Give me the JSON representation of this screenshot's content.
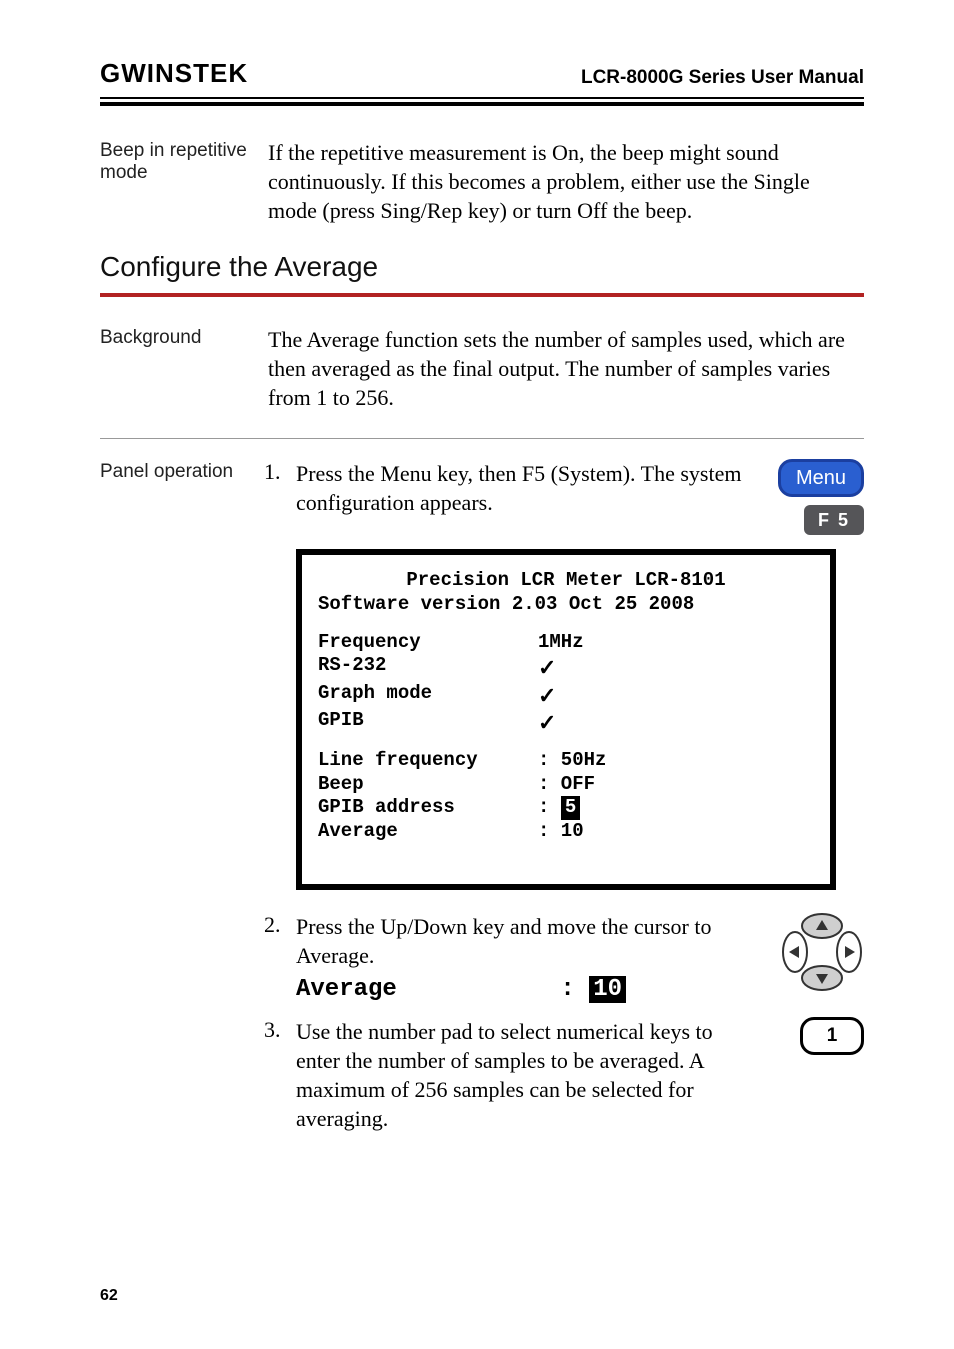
{
  "header": {
    "logo": "GWINSTEK",
    "title": "LCR-8000G Series User Manual"
  },
  "beep": {
    "label": "Beep in repetitive mode",
    "text": "If the repetitive measurement is On, the beep might sound continuously. If this becomes a problem, either use the Single mode (press Sing/Rep key) or turn Off the beep."
  },
  "section_heading": "Configure the Average",
  "background": {
    "label": "Background",
    "text": "The Average function sets the number of samples used, which are then averaged as the final output. The number of samples varies from 1 to 256."
  },
  "panel_op": {
    "label": "Panel operation",
    "steps": [
      {
        "num": "1.",
        "text": "Press the Menu key, then F5 (System). The system configuration appears."
      },
      {
        "num": "2.",
        "text": "Press the Up/Down key and move the cursor to Average."
      },
      {
        "num": "3.",
        "text": "Use the number pad to select numerical keys to enter the number of samples to be averaged. A maximum of 256 samples can be selected for averaging."
      }
    ]
  },
  "buttons": {
    "menu": "Menu",
    "f5": "F 5",
    "one": "1"
  },
  "lcd": {
    "line1": "Precision LCR Meter LCR-8101",
    "line2": "Software version 2.03 Oct 25 2008",
    "freq_k": "Frequency",
    "freq_v": "1MHz",
    "rs232_k": "RS-232",
    "graph_k": "Graph mode",
    "gpib_k": "GPIB",
    "linefreq_k": "Line frequency",
    "linefreq_v": ": 50Hz",
    "beep_k": "Beep",
    "beep_v": ": OFF",
    "gpibaddr_k": "GPIB address",
    "gpibaddr_pre": ": ",
    "gpibaddr_v": "5",
    "avg_k": "Average",
    "avg_v": ": 10"
  },
  "avg_highlight": {
    "label": "Average",
    "pre": ": ",
    "val": "10"
  },
  "page_number": "62"
}
